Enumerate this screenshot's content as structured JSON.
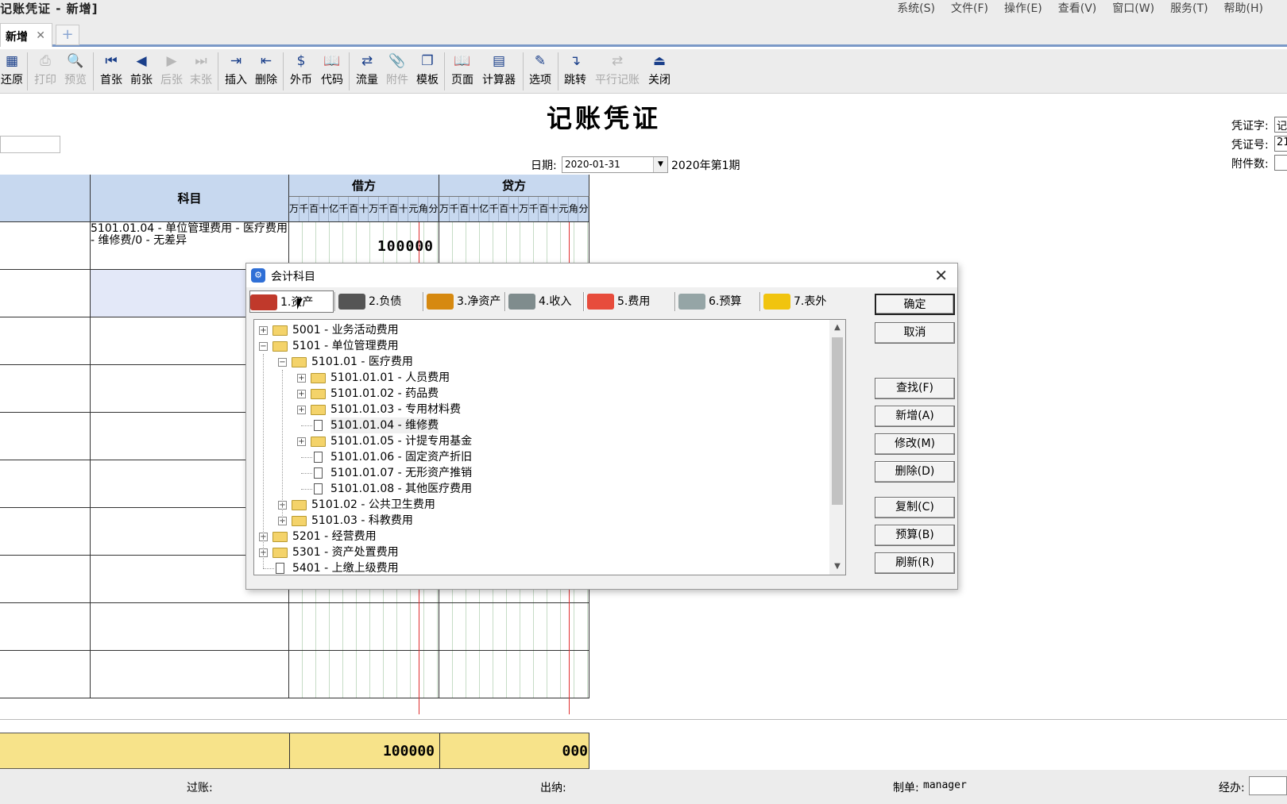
{
  "window": {
    "title": "记账凭证 - 新增]"
  },
  "menu": [
    {
      "label": "系统(S)"
    },
    {
      "label": "文件(F)"
    },
    {
      "label": "操作(E)"
    },
    {
      "label": "查看(V)"
    },
    {
      "label": "窗口(W)"
    },
    {
      "label": "服务(T)"
    },
    {
      "label": "帮助(H)"
    }
  ],
  "tabs": {
    "active_label": "新增",
    "close_glyph": "✕",
    "add_glyph": "+"
  },
  "toolbar": {
    "items": [
      {
        "label": "还原",
        "icon": "restore-icon",
        "glyph": "▦",
        "enabled": true
      },
      {
        "label": "打印",
        "icon": "print-icon",
        "glyph": "⎙",
        "enabled": false
      },
      {
        "label": "预览",
        "icon": "preview-icon",
        "glyph": "🔍",
        "enabled": false
      },
      {
        "label": "首张",
        "icon": "first-icon",
        "glyph": "⏮",
        "enabled": true
      },
      {
        "label": "前张",
        "icon": "prev-icon",
        "glyph": "◀",
        "enabled": true
      },
      {
        "label": "后张",
        "icon": "next-icon",
        "glyph": "▶",
        "enabled": false
      },
      {
        "label": "末张",
        "icon": "last-icon",
        "glyph": "⏭",
        "enabled": false
      },
      {
        "label": "插入",
        "icon": "insert-icon",
        "glyph": "⇥",
        "enabled": true
      },
      {
        "label": "删除",
        "icon": "delete-row-icon",
        "glyph": "⇤",
        "enabled": true
      },
      {
        "label": "外币",
        "icon": "foreign-currency-icon",
        "glyph": "$",
        "enabled": true
      },
      {
        "label": "代码",
        "icon": "code-icon",
        "glyph": "📖",
        "enabled": true
      },
      {
        "label": "流量",
        "icon": "cash-flow-icon",
        "glyph": "⇄",
        "enabled": true
      },
      {
        "label": "附件",
        "icon": "attachment-icon",
        "glyph": "📎",
        "enabled": false
      },
      {
        "label": "模板",
        "icon": "template-icon",
        "glyph": "❐",
        "enabled": true
      },
      {
        "label": "页面",
        "icon": "page-icon",
        "glyph": "📖",
        "enabled": true
      },
      {
        "label": "计算器",
        "icon": "calculator-icon",
        "glyph": "▤",
        "enabled": true
      },
      {
        "label": "选项",
        "icon": "options-icon",
        "glyph": "✎",
        "enabled": true
      },
      {
        "label": "跳转",
        "icon": "jump-icon",
        "glyph": "↴",
        "enabled": true
      },
      {
        "label": "平行记账",
        "icon": "parallel-posting-icon",
        "glyph": "⇄",
        "enabled": false
      },
      {
        "label": "关闭",
        "icon": "close-voucher-icon",
        "glyph": "⏏",
        "enabled": true
      }
    ]
  },
  "voucher": {
    "title": "记账凭证",
    "date_label": "日期:",
    "date_value": "2020-01-31",
    "period": "2020年第1期",
    "right_fields": [
      {
        "label": "凭证字:",
        "value": "记"
      },
      {
        "label": "凭证号:",
        "value": "21"
      },
      {
        "label": "附件数:",
        "value": ""
      }
    ]
  },
  "grid": {
    "subject_header": "科目",
    "debit_header": "借方",
    "credit_header": "贷方",
    "digit_units": [
      "万",
      "千",
      "百",
      "十",
      "亿",
      "千",
      "百",
      "十",
      "万",
      "千",
      "百",
      "十",
      "元",
      "角",
      "分"
    ],
    "rows": [
      {
        "subject": "5101.01.04 - 单位管理费用 - 医疗费用 - 维修费/0 - 无差异",
        "debit": "100000",
        "credit": ""
      },
      {
        "subject": "",
        "debit": "",
        "credit": ""
      },
      {
        "subject": "",
        "debit": "",
        "credit": ""
      },
      {
        "subject": "",
        "debit": "",
        "credit": ""
      },
      {
        "subject": "",
        "debit": "",
        "credit": ""
      },
      {
        "subject": "",
        "debit": "",
        "credit": ""
      },
      {
        "subject": "",
        "debit": "",
        "credit": ""
      },
      {
        "subject": "",
        "debit": "",
        "credit": ""
      },
      {
        "subject": "",
        "debit": "",
        "credit": ""
      },
      {
        "subject": "",
        "debit": "",
        "credit": ""
      }
    ],
    "total_debit": "100000",
    "total_credit": "000"
  },
  "status": {
    "posting_label": "过账:",
    "cashier_label": "出纳:",
    "preparer_label": "制单:",
    "preparer_value": "manager",
    "handler_label": "经办:"
  },
  "dialog": {
    "title": "会计科目",
    "close_glyph": "✕",
    "tabs": [
      {
        "label": "1.资产",
        "icon": "car-icon",
        "color": "#c0392b",
        "active": true
      },
      {
        "label": "2.负债",
        "icon": "ledger-icon",
        "color": "#555555",
        "active": false
      },
      {
        "label": "3.净资产",
        "icon": "coins-icon",
        "color": "#d68910",
        "active": false
      },
      {
        "label": "4.收入",
        "icon": "receipt-icon",
        "color": "#7f8c8d",
        "active": false
      },
      {
        "label": "5.费用",
        "icon": "apple-icon",
        "color": "#e74c3c",
        "active": false
      },
      {
        "label": "6.预算",
        "icon": "faucet-icon",
        "color": "#95a5a6",
        "active": false
      },
      {
        "label": "7.表外",
        "icon": "hand-icon",
        "color": "#f1c40f",
        "active": false
      }
    ],
    "tree": [
      {
        "label": "5001 - 业务活动费用",
        "level": 0,
        "kind": "folder",
        "expander": "+"
      },
      {
        "label": "5101 - 单位管理费用",
        "level": 0,
        "kind": "folder",
        "expander": "-"
      },
      {
        "label": "5101.01 - 医疗费用",
        "level": 1,
        "kind": "folder",
        "expander": "-"
      },
      {
        "label": "5101.01.01 - 人员费用",
        "level": 2,
        "kind": "folder",
        "expander": "+"
      },
      {
        "label": "5101.01.02 - 药品费",
        "level": 2,
        "kind": "folder",
        "expander": "+"
      },
      {
        "label": "5101.01.03 - 专用材料费",
        "level": 2,
        "kind": "folder",
        "expander": "+"
      },
      {
        "label": "5101.01.04 - 维修费",
        "level": 2,
        "kind": "leaf",
        "expander": "",
        "highlight": true
      },
      {
        "label": "5101.01.05 - 计提专用基金",
        "level": 2,
        "kind": "folder",
        "expander": "+"
      },
      {
        "label": "5101.01.06 - 固定资产折旧",
        "level": 2,
        "kind": "leaf",
        "expander": ""
      },
      {
        "label": "5101.01.07 - 无形资产推销",
        "level": 2,
        "kind": "leaf",
        "expander": ""
      },
      {
        "label": "5101.01.08 - 其他医疗费用",
        "level": 2,
        "kind": "leaf",
        "expander": ""
      },
      {
        "label": "5101.02 - 公共卫生费用",
        "level": 1,
        "kind": "folder",
        "expander": "+"
      },
      {
        "label": "5101.03 - 科教费用",
        "level": 1,
        "kind": "folder",
        "expander": "+"
      },
      {
        "label": "5201 - 经营费用",
        "level": 0,
        "kind": "folder",
        "expander": "+"
      },
      {
        "label": "5301 - 资产处置费用",
        "level": 0,
        "kind": "folder",
        "expander": "+"
      },
      {
        "label": "5401 - 上缴上级费用",
        "level": 0,
        "kind": "leaf",
        "expander": ""
      }
    ],
    "scroll_up_glyph": "▲",
    "scroll_down_glyph": "▼",
    "buttons": [
      {
        "label": "确定",
        "name": "ok-button"
      },
      {
        "label": "取消",
        "name": "cancel-button"
      },
      {
        "label": "查找(F)",
        "name": "find-button"
      },
      {
        "label": "新增(A)",
        "name": "add-button"
      },
      {
        "label": "修改(M)",
        "name": "modify-button"
      },
      {
        "label": "删除(D)",
        "name": "delete-button"
      },
      {
        "label": "复制(C)",
        "name": "copy-button"
      },
      {
        "label": "预算(B)",
        "name": "budget-button"
      },
      {
        "label": "刷新(R)",
        "name": "refresh-button"
      }
    ]
  }
}
